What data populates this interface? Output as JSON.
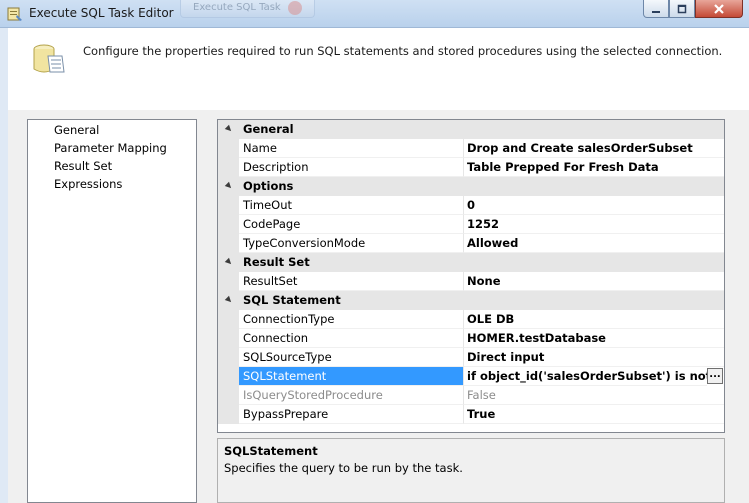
{
  "window": {
    "title": "Execute SQL Task Editor",
    "ghost_tab": "Execute SQL Task"
  },
  "header": {
    "description": "Configure the properties required to run SQL statements and stored procedures using the selected connection."
  },
  "nav": {
    "items": [
      {
        "label": "General"
      },
      {
        "label": "Parameter Mapping"
      },
      {
        "label": "Result Set"
      },
      {
        "label": "Expressions"
      }
    ]
  },
  "grid": {
    "categories": {
      "general": "General",
      "options": "Options",
      "result_set": "Result Set",
      "sql_statement": "SQL Statement"
    },
    "props": {
      "name": {
        "label": "Name",
        "value": "Drop and Create salesOrderSubset"
      },
      "description": {
        "label": "Description",
        "value": "Table Prepped For Fresh Data"
      },
      "timeout": {
        "label": "TimeOut",
        "value": "0"
      },
      "codepage": {
        "label": "CodePage",
        "value": "1252"
      },
      "typeconversion": {
        "label": "TypeConversionMode",
        "value": "Allowed"
      },
      "resultset": {
        "label": "ResultSet",
        "value": "None"
      },
      "connectiontype": {
        "label": "ConnectionType",
        "value": "OLE DB"
      },
      "connection": {
        "label": "Connection",
        "value": "HOMER.testDatabase"
      },
      "sqlsourcetype": {
        "label": "SQLSourceType",
        "value": "Direct input"
      },
      "sqlstatement": {
        "label": "SQLStatement",
        "value": "if object_id('salesOrderSubset') is not null drop table salesOrderSubset"
      },
      "isquerystored": {
        "label": "IsQueryStoredProcedure",
        "value": "False"
      },
      "bypassprepare": {
        "label": "BypassPrepare",
        "value": "True"
      }
    },
    "ellipsis": "..."
  },
  "description_panel": {
    "title": "SQLStatement",
    "text": "Specifies the query to be run by the task."
  },
  "colors": {
    "selection": "#3399ff",
    "gutter": "#e6e6e6",
    "disabled_text": "#8c8c8c"
  }
}
